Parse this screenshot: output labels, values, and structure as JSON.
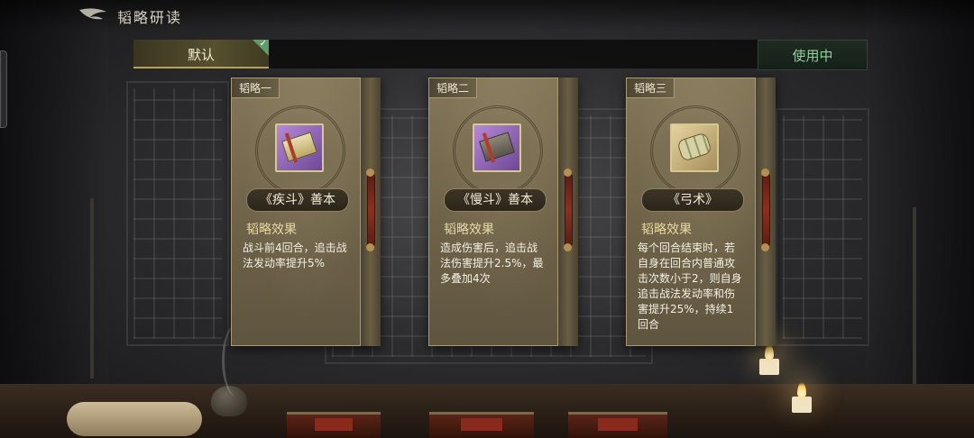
{
  "header": {
    "title": "韬略研读"
  },
  "preset": {
    "active_tab": "默认",
    "status_button": "使用中"
  },
  "cards": [
    {
      "slot": "韬略一",
      "name": "《疾斗》善本",
      "effect_title": "韬略效果",
      "effect_text": "战斗前4回合，追击战法发动率提升5%",
      "icon": "purple-book-icon"
    },
    {
      "slot": "韬略二",
      "name": "《慢斗》善本",
      "effect_title": "韬略效果",
      "effect_text": "造成伤害后，追击战法伤害提升2.5%，最多叠加4次",
      "icon": "purple-book-icon"
    },
    {
      "slot": "韬略三",
      "name": "《弓术》",
      "effect_title": "韬略效果",
      "effect_text": "每个回合结束时，若自身在回合内普通攻击次数小于2，则自身追击战法发动率和伤害提升25%，持续1回合",
      "icon": "gold-scroll-icon"
    }
  ],
  "colors": {
    "accent_gold": "#ead9a2",
    "in_use_green": "#8fd39c",
    "check_green": "#5e9c6a"
  }
}
